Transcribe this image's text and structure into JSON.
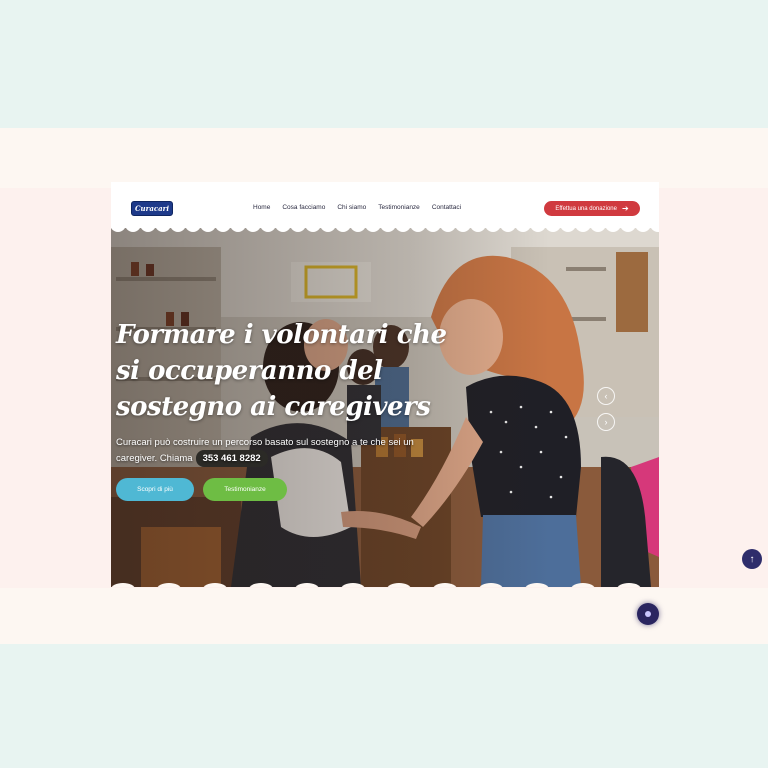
{
  "header": {
    "logo_text": "Curacari",
    "nav": [
      "Home",
      "Cosa facciamo",
      "Chi siamo",
      "Testimonianze",
      "Contattaci"
    ],
    "donate_label": "Effettua una donazione",
    "donate_icon": "arrow-right-icon"
  },
  "hero": {
    "headline": "Formare i volontari che si occuperanno del sostegno ai caregivers",
    "subtext": "Curacari può costruire un percorso basato sul sostegno a te che sei un caregiver. Chiama",
    "phone": "353 461 8282",
    "button_more": "Scopri di più",
    "button_testimonials": "Testimonianze",
    "prev_icon": "chevron-left-icon",
    "next_icon": "chevron-right-icon"
  },
  "floating": {
    "back_to_top_icon": "arrow-up-icon",
    "chat_icon": "chat-bubble-icon"
  },
  "colors": {
    "donate": "#d03a3f",
    "more_button": "#4fb8d4",
    "testimonials_button": "#6ebd44",
    "logo": "#1e3a8a",
    "back_to_top": "#2e2d6b"
  }
}
